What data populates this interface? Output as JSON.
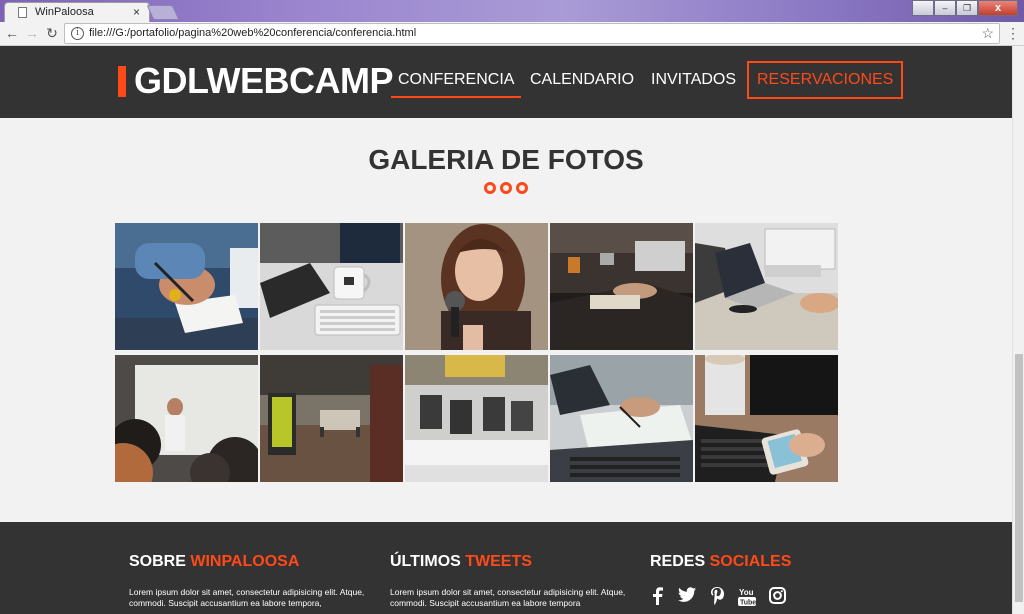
{
  "browser": {
    "tab_title": "WinPaloosa",
    "tab_close": "×",
    "url": "file:///G:/portafolio/pagina%20web%20conferencia/conferencia.html",
    "info_glyph": "i",
    "star_glyph": "☆",
    "menu_glyph": "⋮",
    "back_glyph": "←",
    "forward_glyph": "→",
    "reload_glyph": "↻",
    "minimize_glyph": "‒",
    "maximize_glyph": "❐",
    "close_glyph": "x"
  },
  "header": {
    "logo": "GDLWEBCAMP",
    "nav": [
      {
        "label": "CONFERENCIA",
        "active": true
      },
      {
        "label": "CALENDARIO"
      },
      {
        "label": "INVITADOS"
      },
      {
        "label": "RESERVACIONES",
        "highlight": true
      }
    ]
  },
  "gallery": {
    "title": "GALERIA DE FOTOS",
    "photos": [
      {
        "name": "hand-writing-notebook-photo"
      },
      {
        "name": "desk-keyboard-mug-photo"
      },
      {
        "name": "woman-microphone-photo"
      },
      {
        "name": "meeting-table-photo"
      },
      {
        "name": "laptops-workspace-photo"
      },
      {
        "name": "speaker-presentation-photo"
      },
      {
        "name": "office-hallway-photo"
      },
      {
        "name": "empty-office-chairs-photo"
      },
      {
        "name": "laptop-writing-photo"
      },
      {
        "name": "phone-coffee-keyboard-photo"
      }
    ]
  },
  "footer": {
    "about": {
      "title_a": "SOBRE ",
      "title_b": "WINPALOOSA",
      "text": "Lorem ipsum dolor sit amet, consectetur adipisicing elit. Atque, commodi. Suscipit accusantium ea labore tempora,"
    },
    "tweets": {
      "title_a": "ÚLTIMOS ",
      "title_b": "TWEETS",
      "text": "Lorem ipsum dolor sit amet, consectetur adipisicing elit. Atque, commodi. Suscipit accusantium ea labore tempora"
    },
    "social": {
      "title_a": "REDES ",
      "title_b": "SOCIALES",
      "icons": [
        "facebook-icon",
        "twitter-icon",
        "pinterest-icon",
        "youtube-icon",
        "instagram-icon"
      ]
    }
  },
  "colors": {
    "accent": "#fe4918",
    "dark": "#333333",
    "background": "#f2f2f2"
  }
}
